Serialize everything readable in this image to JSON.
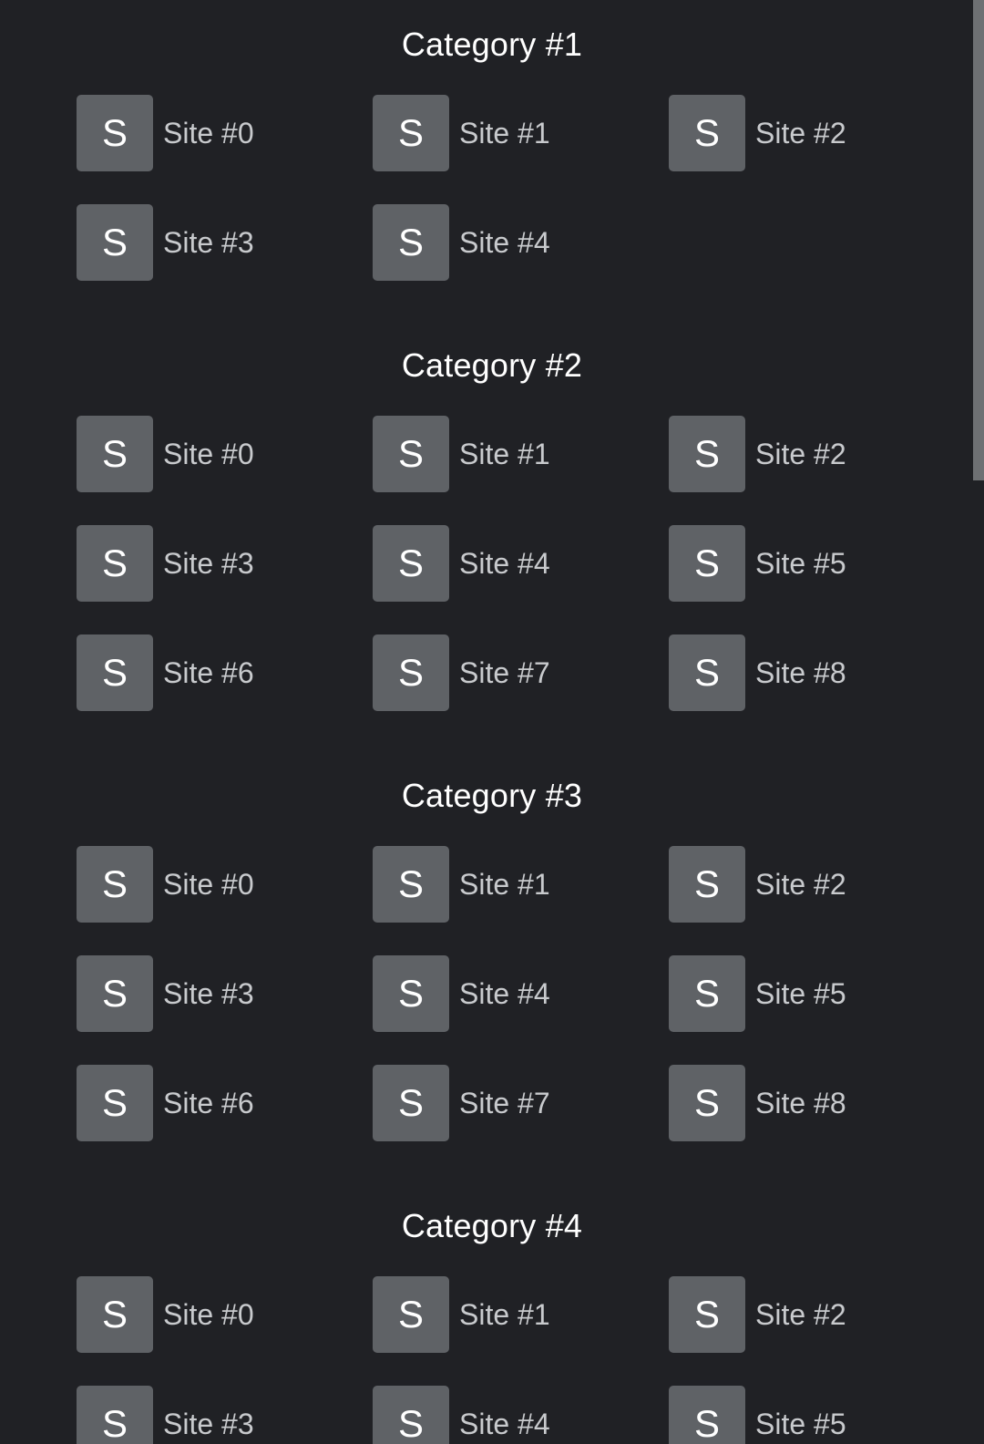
{
  "categories": [
    {
      "title": "Category #1",
      "sites": [
        {
          "icon_letter": "S",
          "label": "Site #0"
        },
        {
          "icon_letter": "S",
          "label": "Site #1"
        },
        {
          "icon_letter": "S",
          "label": "Site #2"
        },
        {
          "icon_letter": "S",
          "label": "Site #3"
        },
        {
          "icon_letter": "S",
          "label": "Site #4"
        }
      ]
    },
    {
      "title": "Category #2",
      "sites": [
        {
          "icon_letter": "S",
          "label": "Site #0"
        },
        {
          "icon_letter": "S",
          "label": "Site #1"
        },
        {
          "icon_letter": "S",
          "label": "Site #2"
        },
        {
          "icon_letter": "S",
          "label": "Site #3"
        },
        {
          "icon_letter": "S",
          "label": "Site #4"
        },
        {
          "icon_letter": "S",
          "label": "Site #5"
        },
        {
          "icon_letter": "S",
          "label": "Site #6"
        },
        {
          "icon_letter": "S",
          "label": "Site #7"
        },
        {
          "icon_letter": "S",
          "label": "Site #8"
        }
      ]
    },
    {
      "title": "Category #3",
      "sites": [
        {
          "icon_letter": "S",
          "label": "Site #0"
        },
        {
          "icon_letter": "S",
          "label": "Site #1"
        },
        {
          "icon_letter": "S",
          "label": "Site #2"
        },
        {
          "icon_letter": "S",
          "label": "Site #3"
        },
        {
          "icon_letter": "S",
          "label": "Site #4"
        },
        {
          "icon_letter": "S",
          "label": "Site #5"
        },
        {
          "icon_letter": "S",
          "label": "Site #6"
        },
        {
          "icon_letter": "S",
          "label": "Site #7"
        },
        {
          "icon_letter": "S",
          "label": "Site #8"
        }
      ]
    },
    {
      "title": "Category #4",
      "sites": [
        {
          "icon_letter": "S",
          "label": "Site #0"
        },
        {
          "icon_letter": "S",
          "label": "Site #1"
        },
        {
          "icon_letter": "S",
          "label": "Site #2"
        },
        {
          "icon_letter": "S",
          "label": "Site #3"
        },
        {
          "icon_letter": "S",
          "label": "Site #4"
        },
        {
          "icon_letter": "S",
          "label": "Site #5"
        }
      ]
    }
  ],
  "colors": {
    "background": "#202125",
    "tile": "#5f6266",
    "title_text": "#ffffff",
    "label_text": "#c8cacd",
    "scrollbar_thumb": "#6e7073"
  }
}
